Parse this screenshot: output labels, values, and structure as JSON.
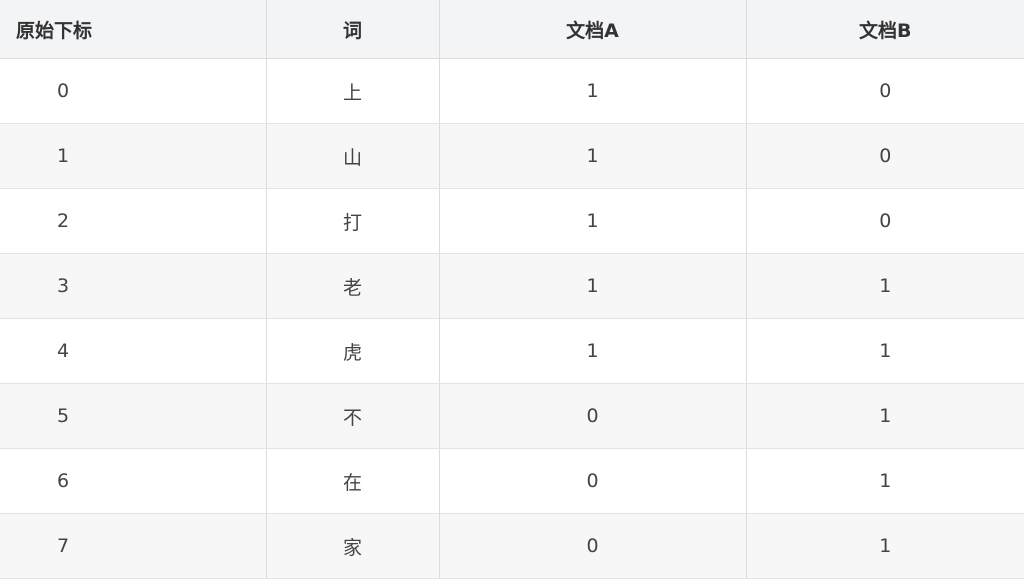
{
  "table": {
    "headers": [
      "原始下标",
      "词",
      "文档A",
      "文档B"
    ],
    "rows": [
      [
        "0",
        "上",
        "1",
        "0"
      ],
      [
        "1",
        "山",
        "1",
        "0"
      ],
      [
        "2",
        "打",
        "1",
        "0"
      ],
      [
        "3",
        "老",
        "1",
        "1"
      ],
      [
        "4",
        "虎",
        "1",
        "1"
      ],
      [
        "5",
        "不",
        "0",
        "1"
      ],
      [
        "6",
        "在",
        "0",
        "1"
      ],
      [
        "7",
        "家",
        "0",
        "1"
      ]
    ]
  }
}
